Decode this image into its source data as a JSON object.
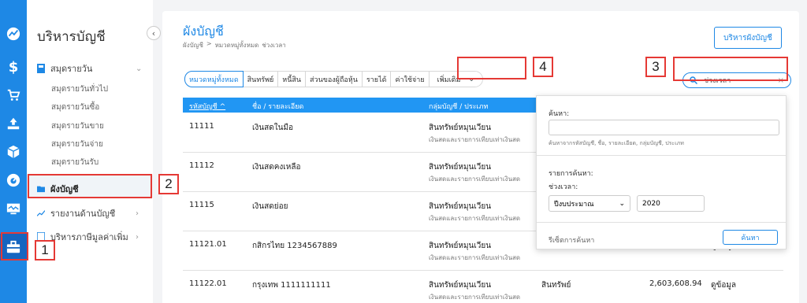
{
  "sidebar": {
    "title": "บริหารบัญชี",
    "sections": [
      {
        "label": "สมุดรายวัน"
      },
      {
        "label": "ผังบัญชี"
      },
      {
        "label": "รายงานด้านบัญชี"
      },
      {
        "label": "บริหารภาษีมูลค่าเพิ่ม"
      }
    ],
    "sub_items": [
      "สมุดรายวันทั่วไป",
      "สมุดรายวันซื้อ",
      "สมุดรายวันขาย",
      "สมุดรายวันจ่าย",
      "สมุดรายวันรับ"
    ]
  },
  "rail_icons": [
    "dashboard-icon",
    "dollar-icon",
    "cart-icon",
    "upload-icon",
    "box-icon",
    "gauge-icon",
    "monitor-icon",
    "briefcase-icon"
  ],
  "header": {
    "title": "ผังบัญชี",
    "breadcrumb": [
      "ผังบัญชี",
      ">",
      "หมวดหมู่ทั้งหมด",
      "ช่วงเวลา"
    ],
    "manage_button": "บริหารผังบัญชี"
  },
  "tabs": [
    "หมวดหมู่ทั้งหมด",
    "สินทรัพย์",
    "หนี้สิน",
    "ส่วนของผู้ถือหุ้น",
    "รายได้",
    "ค่าใช้จ่าย"
  ],
  "more_tab": "เพิ่มเติม",
  "search": {
    "value": "ช่วงเวลา",
    "clear": "×"
  },
  "table": {
    "headers": {
      "code": "รหัสบัญชี ^",
      "name": "ชื่อ / รายละเอียด",
      "group": "กลุ่มบัญชี / ประเภท"
    },
    "rows": [
      {
        "code": "11111",
        "name": "เงินสดในมือ",
        "group": "สินทรัพย์หมุนเวียน",
        "group_sub": "เงินสดและรายการเทียบเท่าเงินสด",
        "type": "",
        "balance": "",
        "action": ""
      },
      {
        "code": "11112",
        "name": "เงินสดคงเหลือ",
        "group": "สินทรัพย์หมุนเวียน",
        "group_sub": "เงินสดและรายการเทียบเท่าเงินสด",
        "type": "",
        "balance": "",
        "action": ""
      },
      {
        "code": "11115",
        "name": "เงินสดย่อย",
        "group": "สินทรัพย์หมุนเวียน",
        "group_sub": "เงินสดและรายการเทียบเท่าเงินสด",
        "type": "",
        "balance": "",
        "action": ""
      },
      {
        "code": "11121.01",
        "name": "กสิกรไทย 1234567889",
        "group": "สินทรัพย์หมุนเวียน",
        "group_sub": "เงินสดและรายการเทียบเท่าเงินสด",
        "type": "",
        "balance": "",
        "action": "ดูข้อมูล"
      },
      {
        "code": "11122.01",
        "name": "กรุงเทพ 1111111111",
        "group": "สินทรัพย์หมุนเวียน",
        "group_sub": "เงินสดและรายการเทียบเท่าเงินสด",
        "type": "สินทรัพย์",
        "balance": "2,603,608.94",
        "action": "ดูข้อมูล"
      }
    ]
  },
  "popover": {
    "search_label": "ค้นหา:",
    "search_hint": "ค้นหาจากรหัสบัญชี, ชื่อ, รายละเอียด, กลุ่มบัญชี, ประเภท",
    "list_label": "รายการค้นหา:",
    "period_label": "ช่วงเวลา:",
    "period_select": "ปีงบประมาณ",
    "year": "2020",
    "reset": "รีเซ็ตการค้นหา",
    "search_button": "ค้นหา"
  },
  "annotations": [
    "1",
    "2",
    "3",
    "4"
  ]
}
